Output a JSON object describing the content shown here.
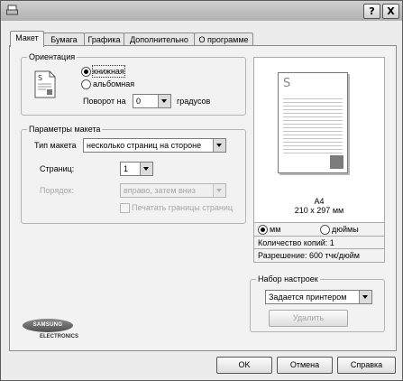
{
  "window": {
    "help_button": "?",
    "close_button": "X"
  },
  "tabs": [
    {
      "label": "Макет"
    },
    {
      "label": "Бумага"
    },
    {
      "label": "Графика"
    },
    {
      "label": "Дополнительно"
    },
    {
      "label": "О программе"
    }
  ],
  "orientation": {
    "group_label": "Ориентация",
    "portrait_label": "книжная",
    "landscape_label": "альбомная",
    "rotate_label": "Поворот на",
    "rotate_value": "0",
    "degrees_label": "градусов"
  },
  "layout": {
    "group_label": "Параметры макета",
    "type_label": "Тип макета",
    "type_value": "несколько страниц на стороне",
    "pages_label": "Страниц:",
    "pages_value": "1",
    "order_label": "Порядок:",
    "order_value": "вправо, затем вниз",
    "print_borders_label": "Печатать границы страниц"
  },
  "preview": {
    "paper_name": "A4",
    "paper_size": "210 x 297 мм",
    "unit_mm": "мм",
    "unit_inch": "дюймы",
    "copies": "Количество копий: 1",
    "resolution": "Разрешение: 600 тчк/дюйм"
  },
  "presets": {
    "group_label": "Набор настроек",
    "value": "Задается принтером",
    "delete_label": "Удалить"
  },
  "brand": {
    "name": "SAMSUNG",
    "sub": "ELECTRONICS"
  },
  "footer": {
    "ok": "OK",
    "cancel": "Отмена",
    "help": "Справка"
  }
}
